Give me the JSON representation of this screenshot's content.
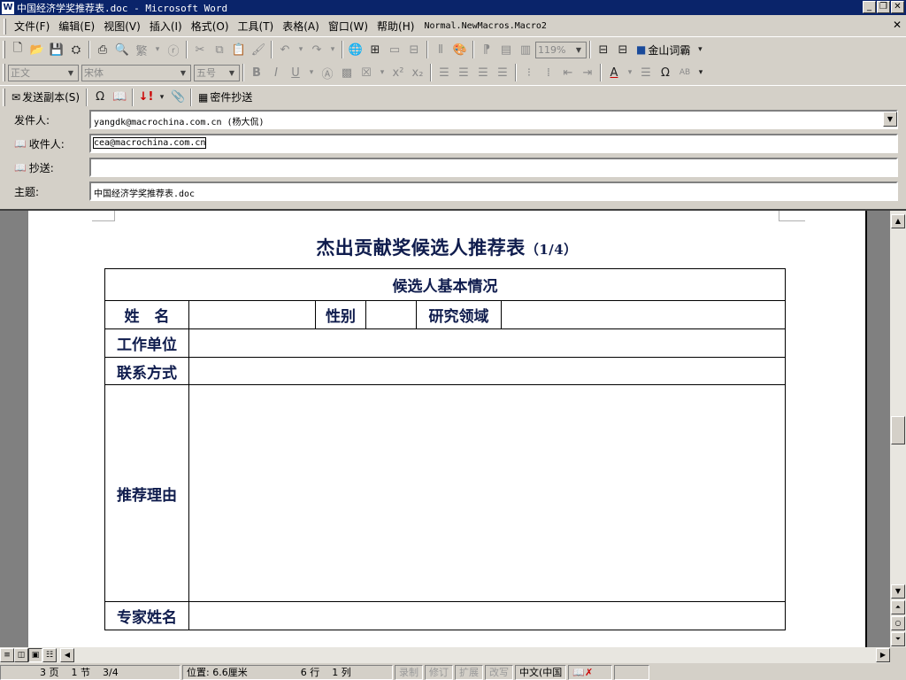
{
  "window": {
    "title": "中国经济学奖推荐表.doc - Microsoft Word",
    "app_icon": "word-icon",
    "buttons": [
      "minimize",
      "restore",
      "close"
    ]
  },
  "menu": {
    "items": [
      "文件(F)",
      "编辑(E)",
      "视图(V)",
      "插入(I)",
      "格式(O)",
      "工具(T)",
      "表格(A)",
      "窗口(W)",
      "帮助(H)"
    ],
    "macro": "Normal.NewMacros.Macro2"
  },
  "toolbar1": {
    "zoom": "119%",
    "kingsoft_label": "金山词霸"
  },
  "toolbar2": {
    "style": "正文",
    "font": "宋体",
    "size": "五号"
  },
  "toolbar3": {
    "send_copy": "发送副本(S)",
    "bcc": "密件抄送"
  },
  "mail": {
    "from_label": "发件人:",
    "from_value": "yangdk@macrochina.com.cn    (杨大侃)",
    "to_label": "收件人:",
    "to_value": "cea@macrochina.com.cn",
    "cc_label": "抄送:",
    "cc_value": "",
    "subject_label": "主题:",
    "subject_value": "中国经济学奖推荐表.doc"
  },
  "document": {
    "title": "杰出贡献奖候选人推荐表",
    "title_page": "（1/4）",
    "section_header": "候选人基本情况",
    "name_label": "姓　名",
    "gender_label": "性别",
    "field_label": "研究领域",
    "workplace_label": "工作单位",
    "contact_label": "联系方式",
    "reason_label": "推荐理由",
    "expert_label": "专家姓名"
  },
  "status": {
    "page": "3 页",
    "section": "1 节",
    "page_of": "3/4",
    "position": "位置: 6.6厘米",
    "line": "6 行",
    "column": "1 列",
    "rec": "录制",
    "trk": "修订",
    "ext": "扩展",
    "ovr": "改写",
    "language": "中文(中国"
  }
}
